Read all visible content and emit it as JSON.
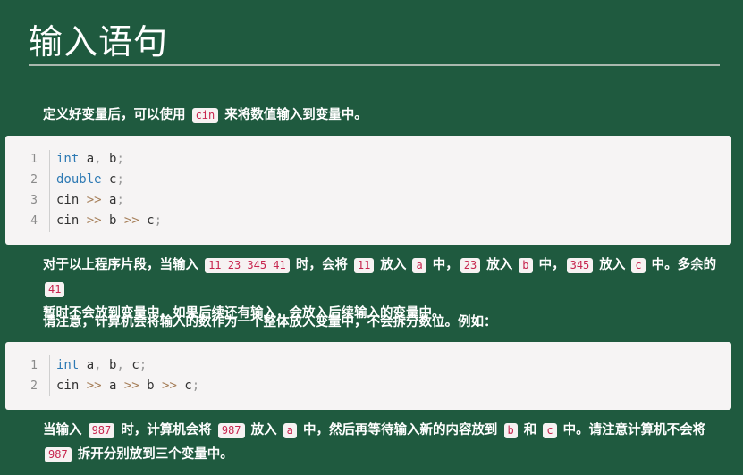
{
  "title": "输入语句",
  "p1": {
    "pre": "定义好变量后，可以使用 ",
    "code": "cin",
    "post": " 来将数值输入到变量中。"
  },
  "code1": {
    "line_numbers": [
      "1",
      "2",
      "3",
      "4"
    ],
    "l1": {
      "kw": "int",
      "rest": " a",
      "sep": ",",
      "rest2": " b",
      "end": ";"
    },
    "l2": {
      "kw": "double",
      "rest": " c",
      "end": ";"
    },
    "l3": {
      "a": "cin ",
      "op": ">>",
      "b": " a",
      "end": ";"
    },
    "l4": {
      "a": "cin ",
      "op1": ">>",
      "b": " b ",
      "op2": ">>",
      "c": " c",
      "end": ";"
    }
  },
  "p2": {
    "t1": "对于以上程序片段，当输入 ",
    "c1": "11 23 345 41",
    "t2": " 时，会将 ",
    "c2": "11",
    "t3": " 放入 ",
    "c3": "a",
    "t4": " 中，",
    "c4": "23",
    "t5": " 放入 ",
    "c5": "b",
    "t6": " 中，",
    "c6": "345",
    "t7": " 放入 ",
    "c7": "c",
    "t8": " 中。多余的 ",
    "c8": "41",
    "t9": "暂时不会放到变量中，如果后续还有输入，会放入后续输入的变量中。"
  },
  "p3": "请注意，计算机会将输入的数作为一个整体放入变量中，不会拆分数位。例如：",
  "code2": {
    "line_numbers": [
      "1",
      "2"
    ],
    "l1": {
      "kw": "int",
      "a": " a",
      "s1": ",",
      "b": " b",
      "s2": ",",
      "c": " c",
      "end": ";"
    },
    "l2": {
      "a": "cin ",
      "op1": ">>",
      "b": " a ",
      "op2": ">>",
      "c": " b ",
      "op3": ">>",
      "d": " c",
      "end": ";"
    }
  },
  "p4": {
    "t1": "当输入 ",
    "c1": "987",
    "t2": " 时，计算机会将 ",
    "c2": "987",
    "t3": " 放入 ",
    "c3": "a",
    "t4": " 中，然后再等待输入新的内容放到 ",
    "c4": "b",
    "t5": " 和 ",
    "c5": "c",
    "t6": " 中。请注意计算机",
    "bold": "不会",
    "t7": "将",
    "c6": "987",
    "t8": " 拆开分别放到三个变量中。"
  },
  "colors": {
    "background": "#1f5a3f",
    "code_bg": "#f6f4f4",
    "inline_code": "#c7254e",
    "keyword": "#2e7ab4",
    "operator": "#a67f59"
  }
}
